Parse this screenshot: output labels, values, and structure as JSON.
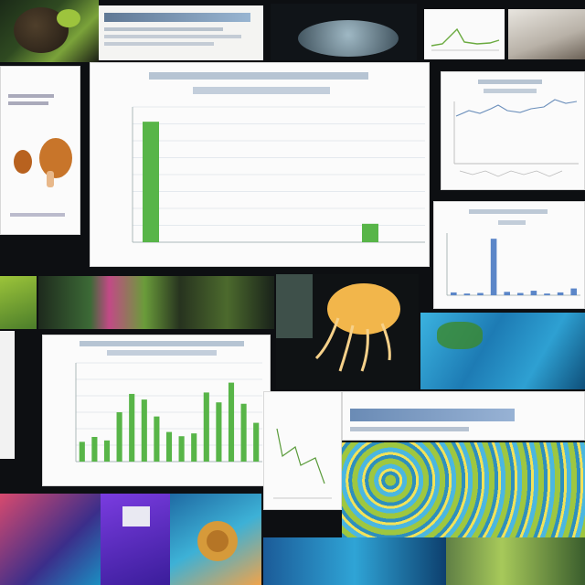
{
  "colors": {
    "background": "#0d0f12",
    "bar_green": "#58b548",
    "bar_blue": "#5b86c8",
    "panel": "#fbfbfb"
  },
  "chart_data": [
    {
      "type": "bar",
      "categories": [
        "",
        "",
        "",
        "",
        "",
        "",
        "",
        ""
      ],
      "values": [
        98,
        0,
        0,
        0,
        0,
        0,
        15,
        0
      ],
      "ylim": [
        0,
        110
      ],
      "grid": true
    },
    {
      "type": "bar",
      "categories": [
        "",
        "",
        "",
        "",
        "",
        "",
        "",
        "",
        "",
        "",
        "",
        "",
        "",
        "",
        ""
      ],
      "values": [
        28,
        35,
        30,
        70,
        96,
        88,
        64,
        42,
        36,
        40,
        98,
        84,
        112,
        82,
        55
      ],
      "ylim": [
        0,
        140
      ],
      "grid": true
    },
    {
      "type": "bar",
      "categories": [
        "",
        "",
        "",
        "",
        "",
        "",
        "",
        "",
        "",
        ""
      ],
      "values": [
        5,
        3,
        4,
        100,
        6,
        4,
        8,
        3,
        5,
        12
      ],
      "ylim": [
        0,
        110
      ],
      "grid": false
    }
  ],
  "icons": {
    "chicken_leg": "chicken-leg-icon",
    "jellyfish": "jellyfish-icon",
    "snail": "snail-icon"
  }
}
